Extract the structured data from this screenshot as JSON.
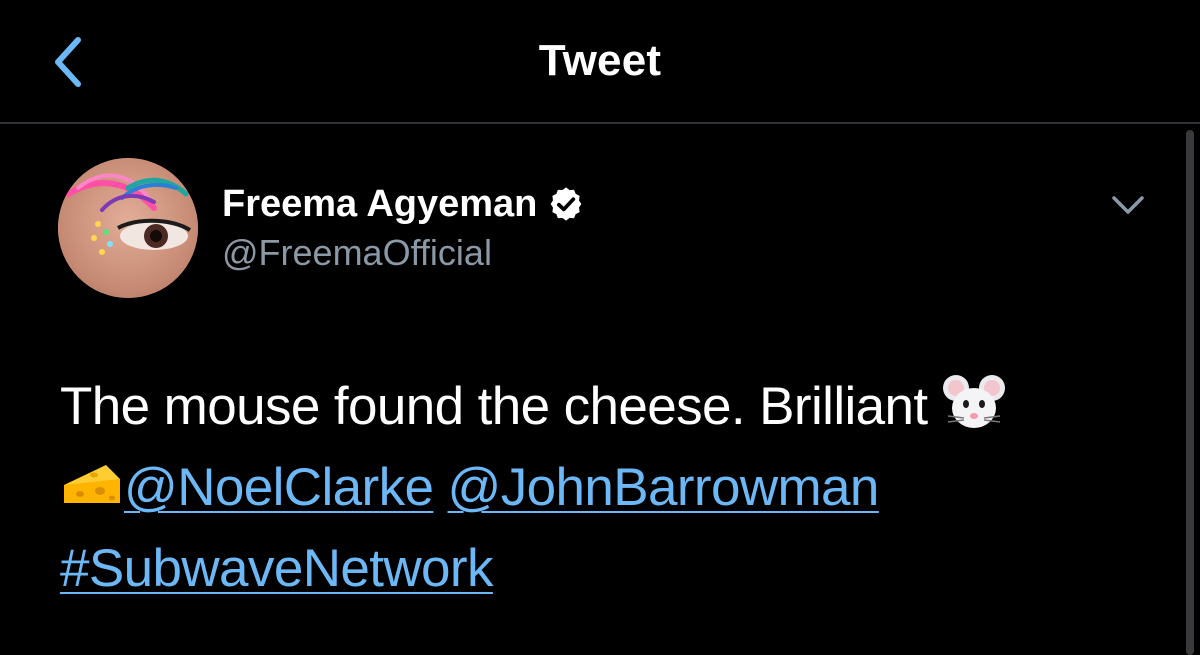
{
  "header": {
    "back_icon": "chevron-left-icon",
    "title": "Tweet"
  },
  "author": {
    "display_name": "Freema Agyeman",
    "handle": "@FreemaOfficial",
    "verified_icon": "verified-badge-icon",
    "avatar": "avatar-image",
    "menu_icon": "chevron-down-icon"
  },
  "tweet": {
    "text_before": "The mouse found the cheese. Brilliant",
    "emoji_1": "mouse-face-emoji",
    "emoji_2": "cheese-wedge-emoji",
    "mention_1": "@NoelClarke",
    "mention_2": "@JohnBarrowman",
    "hashtag": "#SubwaveNetwork"
  },
  "colors": {
    "background": "#000000",
    "accent": "#6cb7f5",
    "secondary_text": "#8b98a5",
    "divider": "#2f3336"
  }
}
